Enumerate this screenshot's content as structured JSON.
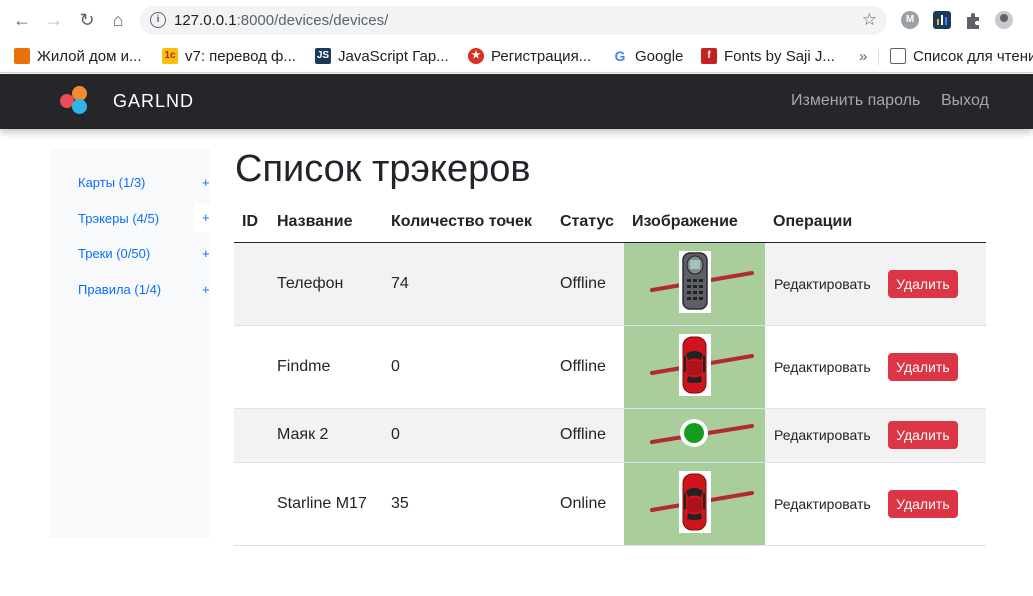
{
  "browser": {
    "url_host": "127.0.0.1",
    "url_path": ":8000/devices/devices/",
    "bookmarks": [
      {
        "label": "Жилой дом и...",
        "color": "#e8710a"
      },
      {
        "label": "v7: перевод ф...",
        "color": "#f4c20d"
      },
      {
        "label": "JavaScript Гар...",
        "color": "#1a3a5c"
      },
      {
        "label": "Регистрация...",
        "color": "#d93025"
      },
      {
        "label": "Google",
        "color": "#4285f4"
      },
      {
        "label": "Fonts by Saji J...",
        "color": "#c5221f"
      },
      {
        "label": "Список для чтени",
        "color": "#5f6368"
      }
    ],
    "more_bookmarks": "»",
    "ext_m_label": "M"
  },
  "navbar": {
    "brand": "GARLND",
    "change_password": "Изменить пароль",
    "logout": "Выход"
  },
  "sidebar": {
    "items": [
      {
        "label": "Карты (1/3)",
        "plus": "+"
      },
      {
        "label": "Трэкеры (4/5)",
        "plus": "+"
      },
      {
        "label": "Треки (0/50)",
        "plus": "+"
      },
      {
        "label": "Правила (1/4)",
        "plus": "+"
      }
    ]
  },
  "main": {
    "title": "Список трэкеров",
    "columns": [
      "ID",
      "Название",
      "Количество точек",
      "Статус",
      "Изображение",
      "Операции"
    ],
    "edit_label": "Редактировать",
    "delete_label": "Удалить",
    "rows": [
      {
        "id": "",
        "name": "Телефон",
        "points": "74",
        "status": "Offline",
        "image": "phone-icon"
      },
      {
        "id": "",
        "name": "Findme",
        "points": "0",
        "status": "Offline",
        "image": "car-icon"
      },
      {
        "id": "",
        "name": "Маяк 2",
        "points": "0",
        "status": "Offline",
        "image": "beacon-dot-icon"
      },
      {
        "id": "",
        "name": "Starline M17",
        "points": "35",
        "status": "Online",
        "image": "car-icon"
      }
    ]
  },
  "colors": {
    "navbar_bg": "#24262a",
    "danger": "#dc3545",
    "link": "#0d6efd",
    "image_bg": "#aacd9c"
  }
}
